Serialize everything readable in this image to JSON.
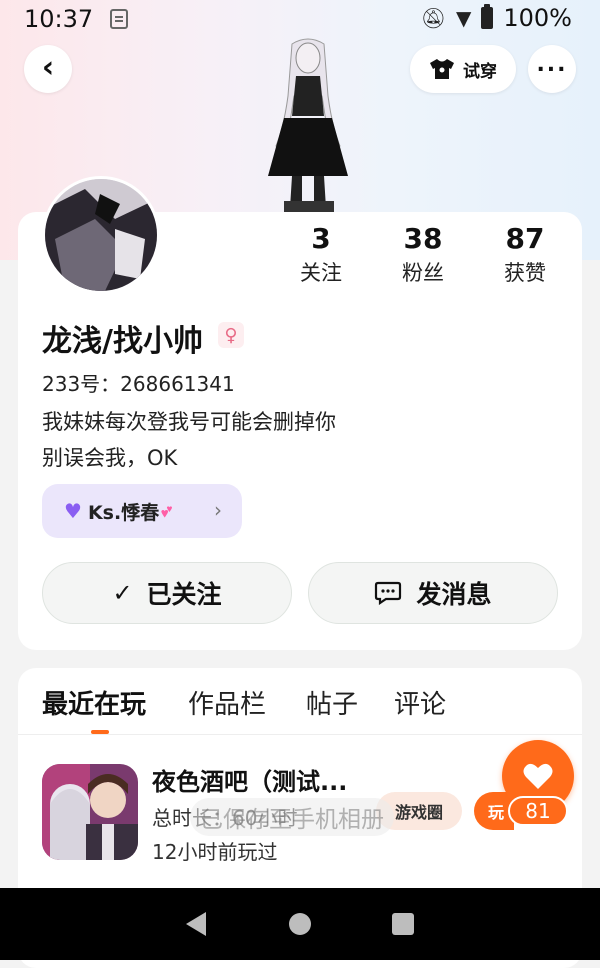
{
  "status_bar": {
    "time": "10:37",
    "battery": "100%"
  },
  "header": {
    "tryon_label": "试穿"
  },
  "profile": {
    "stats": [
      {
        "value": "3",
        "label": "关注"
      },
      {
        "value": "38",
        "label": "粉丝"
      },
      {
        "value": "87",
        "label": "获赞"
      }
    ],
    "name": "龙浅/找小帅",
    "gender_symbol": "♀",
    "id_text": "233号：268661341",
    "bio_lines": [
      "我妹妹每次登我号可能会删掉你",
      "别误会我，OK"
    ],
    "club_chip": "Ks.悸春",
    "follow_button": "已关注",
    "message_button": "发消息"
  },
  "tabs": [
    {
      "label": "最近在玩",
      "active": true
    },
    {
      "label": "作品栏",
      "active": false
    },
    {
      "label": "帖子",
      "active": false
    },
    {
      "label": "评论",
      "active": false
    }
  ],
  "recent_game": {
    "title": "夜色酒吧（测试...",
    "hours": "总时长：60小时",
    "last_played": "12小时前玩过",
    "tag_circle": "游戏圈",
    "tag_play": "玩"
  },
  "toast": "已保存至手机相册",
  "like": {
    "count": "81"
  },
  "colors": {
    "accent": "#ff6a1a",
    "chip_bg": "#ebe6fb",
    "button_bg": "#f4f5f4"
  }
}
